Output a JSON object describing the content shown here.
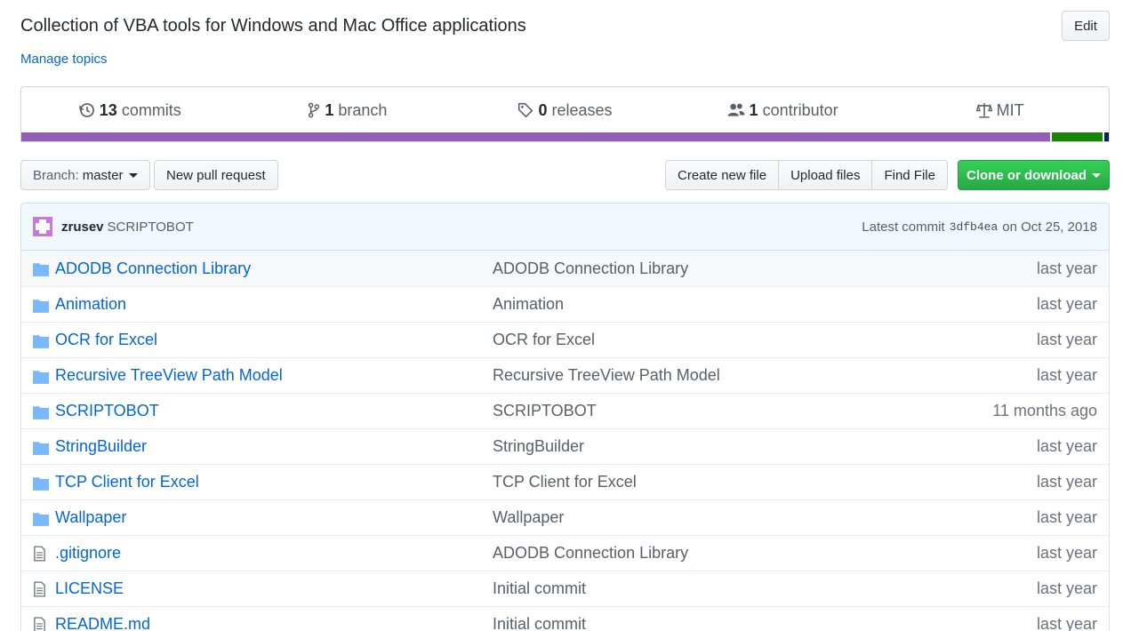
{
  "repo": {
    "description": "Collection of VBA tools for Windows and Mac Office applications",
    "manage_topics": "Manage topics",
    "edit_label": "Edit"
  },
  "summary": {
    "commits": {
      "count": "13",
      "label": "commits",
      "icon": "history-icon"
    },
    "branches": {
      "count": "1",
      "label": "branch",
      "icon": "git-branch-icon"
    },
    "releases": {
      "count": "0",
      "label": "releases",
      "icon": "tag-icon"
    },
    "contributors": {
      "count": "1",
      "label": "contributor",
      "icon": "people-icon"
    },
    "license": {
      "label": "MIT",
      "icon": "law-icon"
    },
    "languages": [
      {
        "color": "#945db7",
        "fraction": 0.966
      },
      {
        "color": "#178600",
        "fraction": 0.048
      },
      {
        "color": "#012456",
        "fraction": 0.004
      }
    ]
  },
  "file_nav": {
    "branch_prefix": "Branch:",
    "branch_name": "master",
    "new_pull_request": "New pull request",
    "create_new_file": "Create new file",
    "upload_files": "Upload files",
    "find_file": "Find File",
    "clone_or_download": "Clone or download"
  },
  "commit": {
    "author": "zrusev",
    "message": "SCRIPTOBOT",
    "latest_label": "Latest commit",
    "sha": "3dfb4ea",
    "on_label": "on Oct 25, 2018"
  },
  "files": [
    {
      "name": "ADODB Connection Library",
      "message": "ADODB Connection Library",
      "age": "last year",
      "type": "directory"
    },
    {
      "name": "Animation",
      "message": "Animation",
      "age": "last year",
      "type": "directory"
    },
    {
      "name": "OCR for Excel",
      "message": "OCR for Excel",
      "age": "last year",
      "type": "directory"
    },
    {
      "name": "Recursive TreeView Path Model",
      "message": "Recursive TreeView Path Model",
      "age": "last year",
      "type": "directory"
    },
    {
      "name": "SCRIPTOBOT",
      "message": "SCRIPTOBOT",
      "age": "11 months ago",
      "type": "directory"
    },
    {
      "name": "StringBuilder",
      "message": "StringBuilder",
      "age": "last year",
      "type": "directory"
    },
    {
      "name": "TCP Client for Excel",
      "message": "TCP Client for Excel",
      "age": "last year",
      "type": "directory"
    },
    {
      "name": "Wallpaper",
      "message": "Wallpaper",
      "age": "last year",
      "type": "directory"
    },
    {
      "name": ".gitignore",
      "message": "ADODB Connection Library",
      "age": "last year",
      "type": "file"
    },
    {
      "name": "LICENSE",
      "message": "Initial commit",
      "age": "last year",
      "type": "file"
    },
    {
      "name": "README.md",
      "message": "Initial commit",
      "age": "last year",
      "type": "file"
    }
  ]
}
